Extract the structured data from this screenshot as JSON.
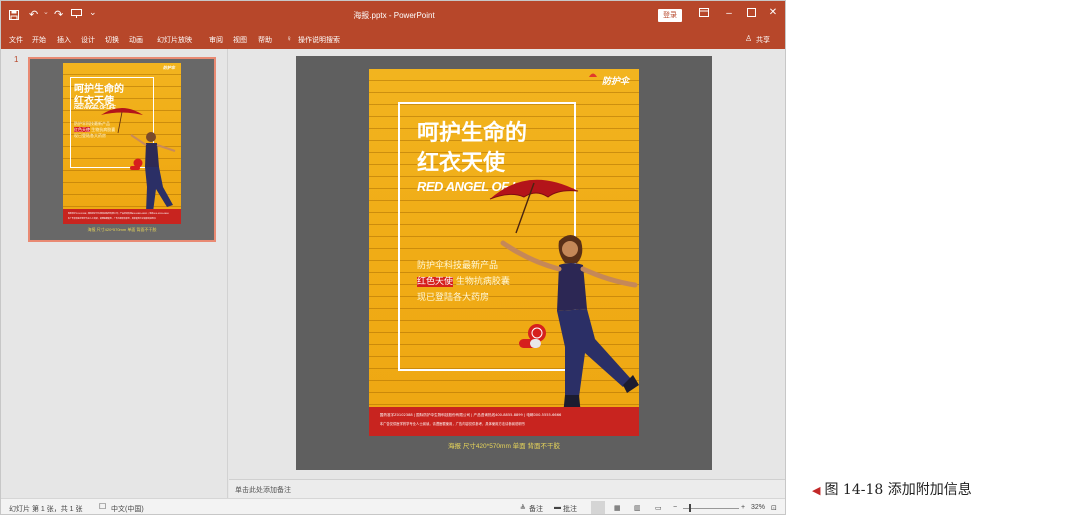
{
  "titlebar": {
    "doc_title": "海报.pptx  -  PowerPoint",
    "login": "登录",
    "share": "共享",
    "icons": [
      "save-icon",
      "undo-icon",
      "redo-icon",
      "start-from-beginning-icon",
      "customize-qat-icon",
      "ribbon-display-icon",
      "minimize-icon",
      "maximize-icon",
      "close-icon"
    ]
  },
  "tabs": [
    "文件",
    "开始",
    "插入",
    "设计",
    "切换",
    "动画",
    "幻灯片放映",
    "审阅",
    "视图",
    "帮助"
  ],
  "tellme": "操作说明搜索",
  "thumbnail": {
    "slide_number": "1"
  },
  "poster": {
    "logo": "防护伞",
    "title_line1": "呵护生命的",
    "title_line2": "红衣天使",
    "subtitle": "RED ANGEL OF LIFE",
    "info_line1": "防护伞科技最新产品",
    "info_highlight": "红色天使",
    "info_line2_rest": " 生物抗病胶囊",
    "info_line3": "现已登陆各大药房",
    "footer_line1": "国药准字Z0102388 | 国际防护伞生物科技股份有限公司 | 产品咨询热线400-8855-8899 | 电邮000-5555-6666",
    "footer_line2": "本广告仅供医学药学专业人士阅读，请遵医嘱使用，广告内容仅供参考，具体使用方法请参阅说明书"
  },
  "poster_caption": "海报  尺寸420*570mm  单面  背面不干胶",
  "notes_placeholder": "单击此处添加备注",
  "statusbar": {
    "slide_info": "幻灯片 第 1 张，共 1 张",
    "language": "中文(中国)",
    "notes": "备注",
    "comments": "批注",
    "zoom": "32%"
  },
  "figure_caption": "图 14-18   添加附加信息",
  "colors": {
    "accent": "#b7472a",
    "poster_yellow": "#f0ac16",
    "poster_red": "#c8241f"
  }
}
